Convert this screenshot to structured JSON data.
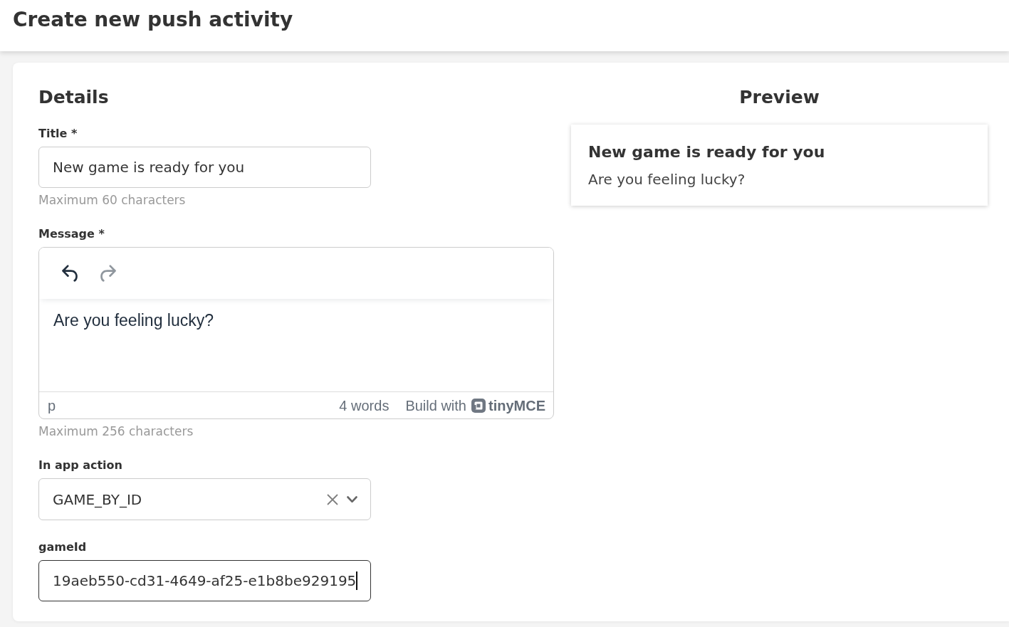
{
  "page": {
    "title": "Create new push activity"
  },
  "details": {
    "heading": "Details",
    "fields": [
      {
        "kind": "text",
        "label": "Title *",
        "value": "New game is ready for you",
        "hint": "Maximum 60 characters",
        "focused": false
      },
      {
        "kind": "editor",
        "label": "Message *",
        "value": "Are you feeling lucky?",
        "hint": "Maximum 256 characters",
        "toolbar": [
          {
            "kind": "undo",
            "disabled": false
          },
          {
            "kind": "redo",
            "disabled": true
          }
        ],
        "status_bar": {
          "path": "p",
          "word_count": "4 words",
          "branding": {
            "prefix": "Build with",
            "brand": "tinyMCE"
          }
        }
      },
      {
        "kind": "select",
        "label": "In app action",
        "value": "GAME_BY_ID"
      },
      {
        "kind": "text",
        "label": "gameId",
        "value": "19aeb550-cd31-4649-af25-e1b8be929195",
        "focused": true
      }
    ]
  },
  "preview": {
    "heading": "Preview",
    "title": "New game is ready for you",
    "message": "Are you feeling lucky?"
  }
}
